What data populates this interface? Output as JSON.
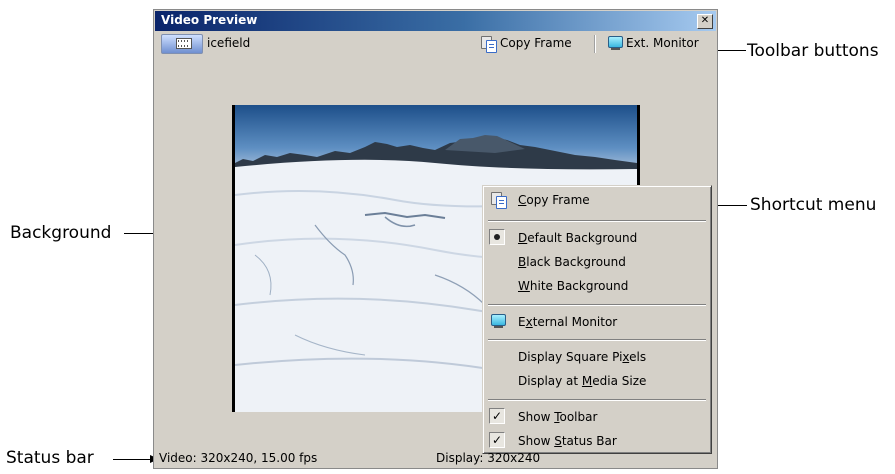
{
  "window": {
    "title": "Video Preview",
    "close_glyph": "✕"
  },
  "toolbar": {
    "media_name": "icefield",
    "copy_frame_label": "Copy Frame",
    "ext_monitor_label": "Ext. Monitor"
  },
  "menu": {
    "items": [
      {
        "prefix": "",
        "accel": "C",
        "suffix": "opy Frame",
        "icon": "copy-frame-icon"
      },
      {
        "prefix": "",
        "accel": "D",
        "suffix": "efault Background",
        "state": "radio-selected"
      },
      {
        "prefix": "",
        "accel": "B",
        "suffix": "lack Background"
      },
      {
        "prefix": "",
        "accel": "W",
        "suffix": "hite Background"
      },
      {
        "prefix": "E",
        "accel": "x",
        "suffix": "ternal Monitor",
        "icon": "monitor-icon"
      },
      {
        "prefix": "Display Square Pi",
        "accel": "x",
        "suffix": "els"
      },
      {
        "prefix": "Display at ",
        "accel": "M",
        "suffix": "edia Size"
      },
      {
        "prefix": "Show ",
        "accel": "T",
        "suffix": "oolbar",
        "state": "checked"
      },
      {
        "prefix": "Show ",
        "accel": "S",
        "suffix": "tatus Bar",
        "state": "checked"
      }
    ],
    "check_glyph": "✓"
  },
  "statusbar": {
    "video_info": "Video: 320x240, 15.00 fps",
    "display_info": "Display: 320x240"
  },
  "callouts": {
    "toolbar_buttons": "Toolbar buttons",
    "shortcut_menu": "Shortcut menu",
    "background": "Background",
    "status_bar": "Status bar"
  },
  "colors": {
    "title_bar_start": "#0a246a",
    "title_bar_end": "#a6caf0",
    "window_face": "#d4d0c8"
  }
}
